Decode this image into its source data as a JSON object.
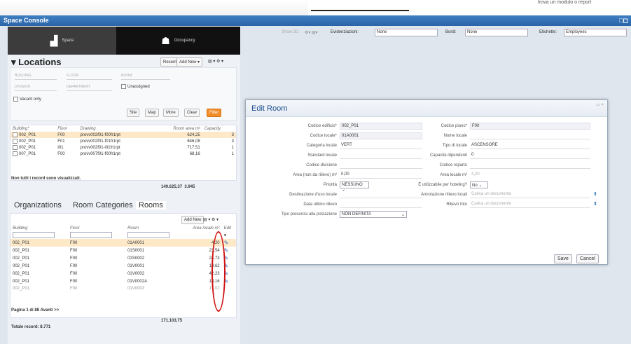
{
  "topbar": {
    "hint": "trova un modulo o report"
  },
  "app": {
    "title": "Space Console",
    "window_icons": "□◻"
  },
  "tabs": [
    {
      "label": "Space",
      "icon": "building-icon"
    },
    {
      "label": "Occupancy",
      "icon": "people-icon"
    }
  ],
  "locations": {
    "title": "▾ Locations",
    "recent": "Recent ▾",
    "add_new": "Add New ▾",
    "icons": "▤ ▾  ⚙ ▾",
    "filters": {
      "building": "BUILDING",
      "floor": "FLOOR",
      "room": "ROOM",
      "division": "DIVISION",
      "department": "DEPARTMENT",
      "unassigned": "Unassigned",
      "vacant": "Vacant only"
    },
    "buttons": {
      "site": "Site",
      "map": "Map",
      "more": "More",
      "clear": "Clear",
      "filter": "Filter"
    },
    "columns": [
      "Building*",
      "Floor",
      "Drawing",
      "Room area m²",
      "Capacity"
    ],
    "rows": [
      [
        "002_P01",
        "F00",
        "provv002f01-f00fr1rpt",
        "624,25",
        "3"
      ],
      [
        "002_P01",
        "F01",
        "provv002f01-f01fr1rpt",
        "646,08",
        "3"
      ],
      [
        "002_P01",
        "I01",
        "provv002f01-i01fr1rpt",
        "717,51",
        "1"
      ],
      [
        "007_P01",
        "F00",
        "provv007f01-f00fr1rpt",
        "68,16",
        "1"
      ]
    ],
    "warning": "Non tutti i record sono visualizzati.",
    "total_area": "149.625,37",
    "total_capacity": "3.945"
  },
  "lower_tabs": {
    "organizations": "Organizations",
    "room_categories": "Room Categories",
    "rooms": "Rooms"
  },
  "rooms": {
    "add_new": "Add New",
    "icons": "▤ ▾  ⚙ ▾",
    "columns": [
      "Building",
      "Floor",
      "Room",
      "Area locale m²",
      "Edit"
    ],
    "rows": [
      [
        "002_P01",
        "F00",
        "01A0001",
        "4,20"
      ],
      [
        "002_P01",
        "F00",
        "01S0001",
        "23,54"
      ],
      [
        "002_P01",
        "F00",
        "01S0002",
        "24,73"
      ],
      [
        "002_P01",
        "F00",
        "01V0001",
        "19,62"
      ],
      [
        "002_P01",
        "F00",
        "01V0002",
        "42,23"
      ],
      [
        "002_P01",
        "F00",
        "01V0002A",
        "18,16"
      ],
      [
        "002_P01",
        "F00",
        "01V0003",
        "17,02"
      ]
    ],
    "pager": "Pagina 1 di 88   Avanti >>",
    "total_area": "171.103,75",
    "total_records": "Totale record: 8.771"
  },
  "map_toolbar": {
    "show3d": "Show 3D",
    "highlight_label": "Evidenziazioni:",
    "highlight": "None",
    "borders_label": "Bordi:",
    "borders": "None",
    "labels_label": "Etichette:",
    "labels": "Employees"
  },
  "edit_room": {
    "title": "Edit Room",
    "close": "▭ ×",
    "left": [
      {
        "label": "Codice edificio*",
        "value": "002_P01"
      },
      {
        "label": "Codice locale*",
        "value": "01A0001"
      },
      {
        "label": "Categoria locale",
        "value": "VERT"
      },
      {
        "label": "Standard locale",
        "value": ""
      },
      {
        "label": "Codice divisione",
        "value": ""
      },
      {
        "label": "Area (non da rilievo) m²",
        "value": "0,00"
      },
      {
        "label": "Priorità",
        "value": "NESSUNO"
      },
      {
        "label": "Destinazione d'uso locale",
        "value": ""
      },
      {
        "label": "Data ultimo rilievo",
        "value": ""
      },
      {
        "label": "Tipo presenza alla postazione",
        "value": "NON DEFINITA"
      }
    ],
    "right": [
      {
        "label": "Codice piano*",
        "value": "F00"
      },
      {
        "label": "Nome locale",
        "value": ""
      },
      {
        "label": "Tipo di locale",
        "value": "ASCENSORE"
      },
      {
        "label": "Capacità dipendenti",
        "value": "0"
      },
      {
        "label": "Codice reparto",
        "value": ""
      },
      {
        "label": "Area locale m²",
        "value": "4,20"
      },
      {
        "label": "È utilizzabile per hoteling?",
        "value": "No"
      },
      {
        "label": "Annotazione rilievo locali",
        "value": "Carica un documento"
      },
      {
        "label": "Rilievo foto",
        "value": "Carica un documento"
      }
    ],
    "save": "Save",
    "cancel": "Cancel"
  }
}
